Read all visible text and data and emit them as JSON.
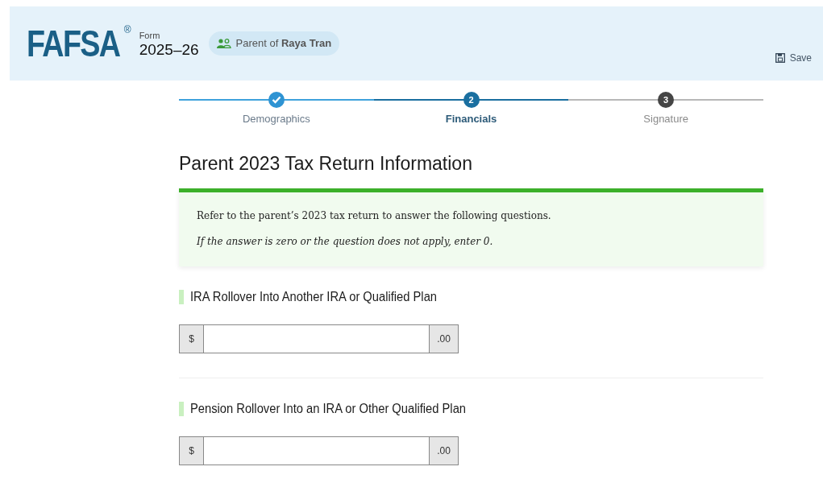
{
  "header": {
    "logo": "FAFSA",
    "logo_mark": "®",
    "form_label": "Form",
    "form_year": "2025–26",
    "role_badge": "Parent of **Raya Tran**",
    "save": "Save"
  },
  "steps": [
    {
      "label": "Demographics",
      "completed": true,
      "selected": false
    },
    {
      "label": "Financials",
      "number": "2",
      "completed": false,
      "selected": true
    },
    {
      "label": "Signature",
      "number": "3",
      "completed": false,
      "selected": false
    }
  ],
  "page_title": "Parent 2023 Tax Return Information",
  "notice": {
    "text": "Refer to the parent’s 2023 tax return to answer the following questions.",
    "note": "If the answer is zero or the question does not apply, enter 0."
  },
  "questions": [
    {
      "label": "IRA Rollover Into Another IRA or Qualified Plan",
      "prefix": "$",
      "suffix": ".00"
    },
    {
      "label": "Pension Rollover Into an IRA or Other Qualified Plan",
      "prefix": "$",
      "suffix": ".00"
    }
  ]
}
